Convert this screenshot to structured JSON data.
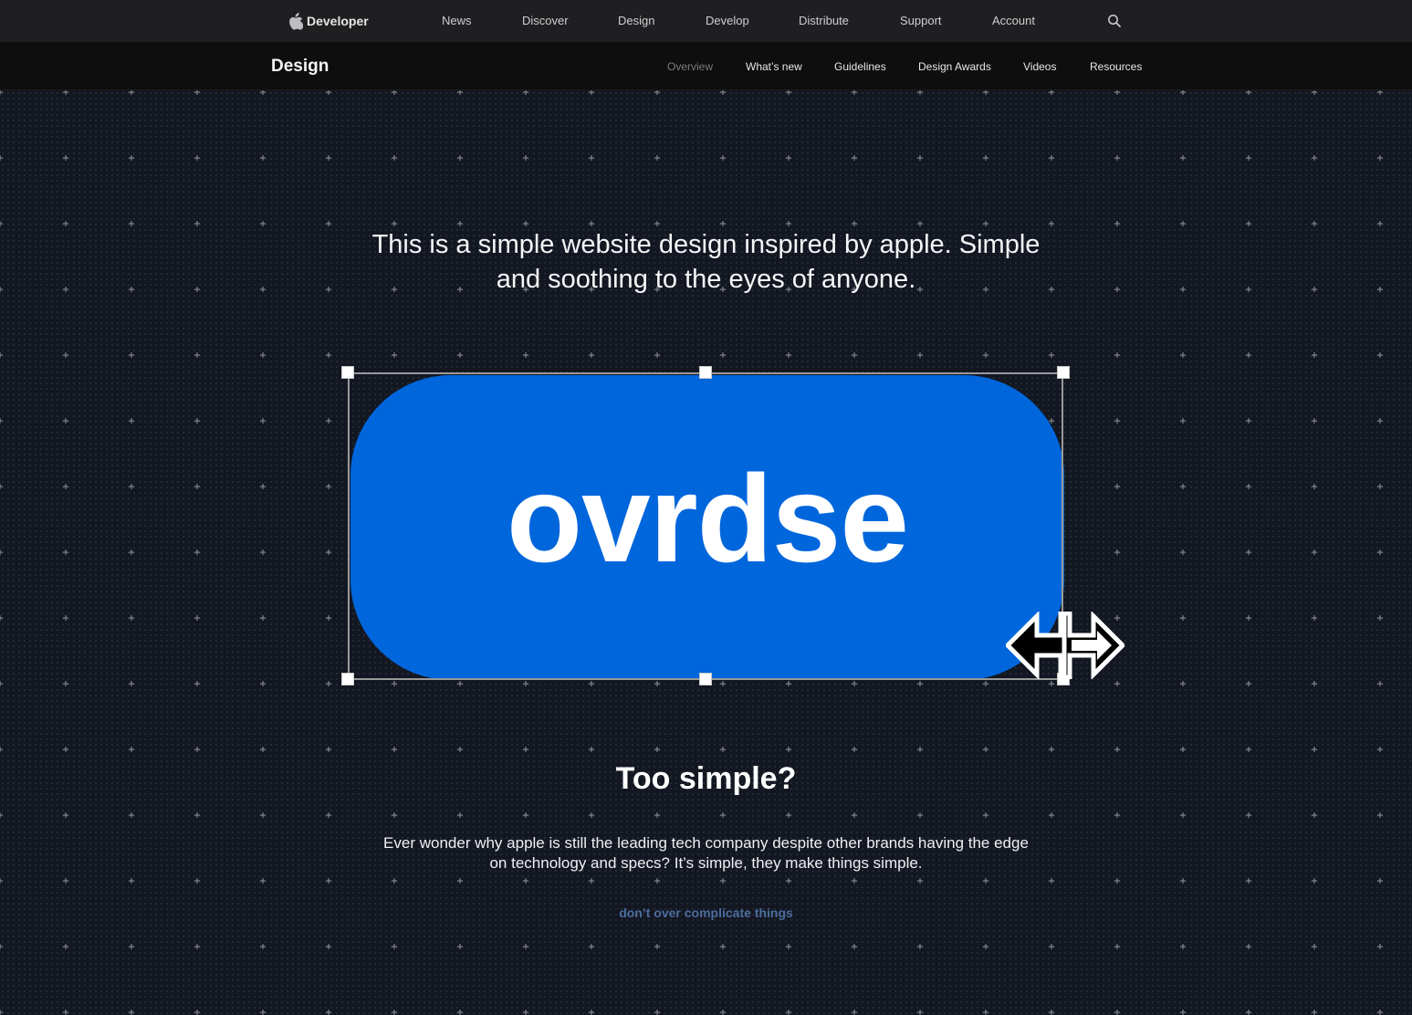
{
  "global_nav": {
    "brand": "Developer",
    "items": [
      "News",
      "Discover",
      "Design",
      "Develop",
      "Distribute",
      "Support",
      "Account"
    ],
    "search_icon": "search-icon"
  },
  "local_nav": {
    "title": "Design",
    "items": [
      "Overview",
      "What’s new",
      "Guidelines",
      "Design Awards",
      "Videos",
      "Resources"
    ],
    "current": "Overview"
  },
  "hero": {
    "intro": "This is a simple website design inspired by apple. Simple and soothing to the eyes of anyone.",
    "logo_text": "ovrdse",
    "logo_color": "#0066dc"
  },
  "section": {
    "title": "Too simple?",
    "body": "Ever wonder why apple is still the leading tech company despite other brands having the edge on technology and specs? It’s simple, they make things simple.",
    "link": "don’t over complicate things"
  }
}
